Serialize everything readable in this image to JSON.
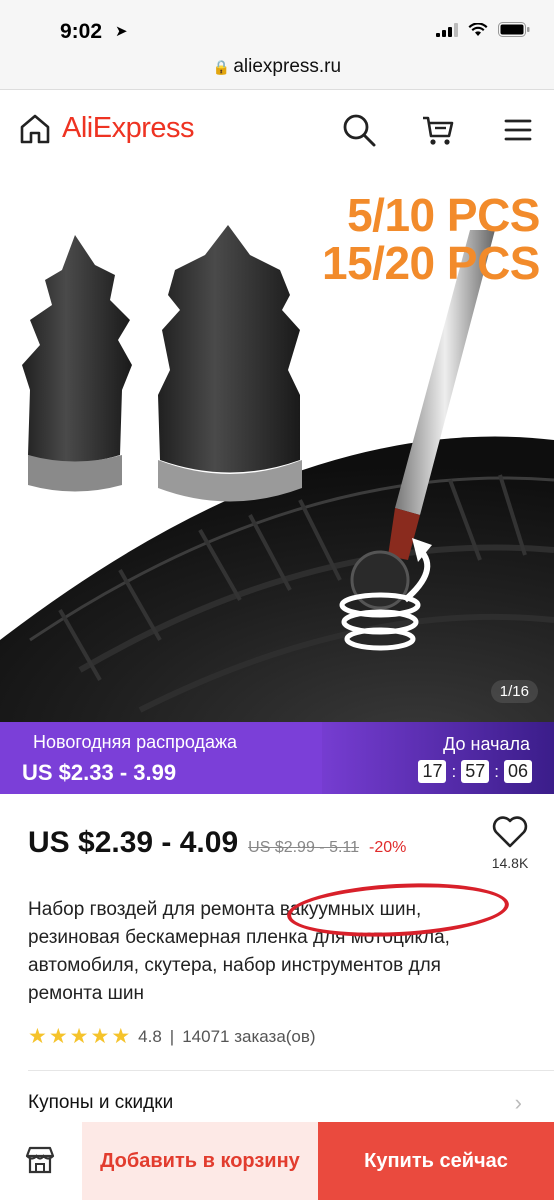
{
  "status": {
    "time": "9:02"
  },
  "browser": {
    "url": "aliexpress.ru"
  },
  "header": {
    "logo": "AliExpress"
  },
  "hero": {
    "promo_line1": "5/10 PCS",
    "promo_line2": "15/20 PCS",
    "image_counter": "1/16"
  },
  "sale_banner": {
    "title": "Новогодняя распродажа",
    "price_range": "US $2.33 - 3.99",
    "starts_label": "До начала",
    "timer": {
      "hours": "17",
      "minutes": "57",
      "seconds": "06"
    }
  },
  "product": {
    "price": "US $2.39 - 4.09",
    "old_price": "US $2.99 - 5.11",
    "discount": "-20%",
    "wishlist_count": "14.8K",
    "title": "Набор гвоздей для ремонта вакуумных шин, резиновая бескамерная пленка для мотоцикла, автомобиля, скутера, набор инструментов для ремонта шин",
    "rating": "4.8",
    "orders": "14071 заказа(ов)",
    "rating_separator": "|"
  },
  "coupons": {
    "label": "Купоны и скидки"
  },
  "bottom_bar": {
    "add_to_cart": "Добавить в корзину",
    "buy_now": "Купить сейчас"
  },
  "colors": {
    "brand": "#ee3322",
    "promo_orange": "#f28b2b",
    "sale_purple": "#7b3fd8",
    "buy_red": "#ea4a3e",
    "annotation_red": "#d8202a"
  }
}
